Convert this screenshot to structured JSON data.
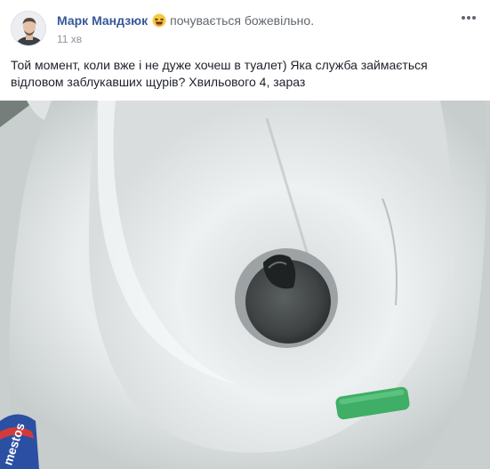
{
  "post": {
    "author_name": "Марк Мандзюк",
    "feeling_icon": "laughing-face-icon",
    "feeling_text": "почувається божевільно.",
    "time_ago": "11 хв",
    "menu_icon": "more-horizontal-icon",
    "text_line1": "Той момент, коли вже і не дуже хочеш в туалет) Яка служба займається",
    "text_line2": "відловом заблукавших щурів? Хвильового 4, зараз",
    "photo": {
      "visible_label_fragment": "mestos"
    }
  },
  "colors": {
    "author_link": "#365899",
    "secondary_text": "#90949c",
    "body_text": "#1d2129",
    "feeling_text": "#616770"
  }
}
